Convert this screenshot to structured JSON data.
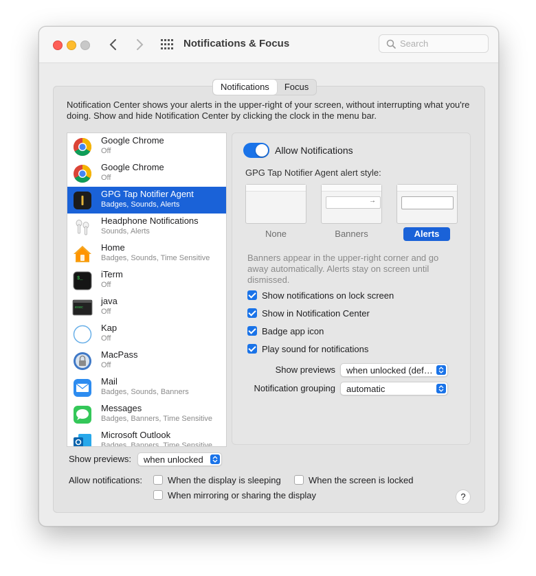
{
  "window": {
    "title": "Notifications & Focus"
  },
  "search": {
    "placeholder": "Search"
  },
  "tabs": [
    {
      "label": "Notifications",
      "active": true
    },
    {
      "label": "Focus",
      "active": false
    }
  ],
  "intro": "Notification Center shows your alerts in the upper-right of your screen, without interrupting what you're doing. Show and hide Notification Center by clicking the clock in the menu bar.",
  "apps": [
    {
      "name": "Google Chrome",
      "sub": "Off",
      "icon": "chrome-icon"
    },
    {
      "name": "Google Chrome",
      "sub": "Off",
      "icon": "chrome-icon"
    },
    {
      "name": "GPG Tap Notifier Agent",
      "sub": "Badges, Sounds, Alerts",
      "icon": "gpg-tap-icon",
      "selected": true
    },
    {
      "name": "Headphone Notifications",
      "sub": "Sounds, Alerts",
      "icon": "airpods-icon"
    },
    {
      "name": "Home",
      "sub": "Badges, Sounds, Time Sensitive",
      "icon": "home-icon"
    },
    {
      "name": "iTerm",
      "sub": "Off",
      "icon": "iterm-icon"
    },
    {
      "name": "java",
      "sub": "Off",
      "icon": "java-icon"
    },
    {
      "name": "Kap",
      "sub": "Off",
      "icon": "kap-icon"
    },
    {
      "name": "MacPass",
      "sub": "Off",
      "icon": "macpass-icon"
    },
    {
      "name": "Mail",
      "sub": "Badges, Sounds, Banners",
      "icon": "mail-icon"
    },
    {
      "name": "Messages",
      "sub": "Badges, Banners, Time Sensitive",
      "icon": "messages-icon"
    },
    {
      "name": "Microsoft Outlook",
      "sub": "Badges, Banners, Time Sensitive",
      "icon": "outlook-icon"
    }
  ],
  "detail": {
    "allow_label": "Allow Notifications",
    "allow_on": true,
    "style_label": "GPG Tap Notifier Agent alert style:",
    "styles": [
      "None",
      "Banners",
      "Alerts"
    ],
    "selected_style": "Alerts",
    "description": "Banners appear in the upper-right corner and go away automatically. Alerts stay on screen until dismissed.",
    "checkboxes": [
      {
        "label": "Show notifications on lock screen",
        "checked": true
      },
      {
        "label": "Show in Notification Center",
        "checked": true
      },
      {
        "label": "Badge app icon",
        "checked": true
      },
      {
        "label": "Play sound for notifications",
        "checked": true
      }
    ],
    "show_previews_label": "Show previews",
    "show_previews_value": "when unlocked (def…",
    "grouping_label": "Notification grouping",
    "grouping_value": "automatic"
  },
  "footer": {
    "show_previews_label": "Show previews:",
    "show_previews_value": "when unlocked",
    "allow_label": "Allow notifications:",
    "opt_sleeping": "When the display is sleeping",
    "opt_locked": "When the screen is locked",
    "opt_mirroring": "When mirroring or sharing the display",
    "help": "?"
  },
  "colors": {
    "accent": "#1a73e8",
    "selection": "#1a62d8"
  }
}
